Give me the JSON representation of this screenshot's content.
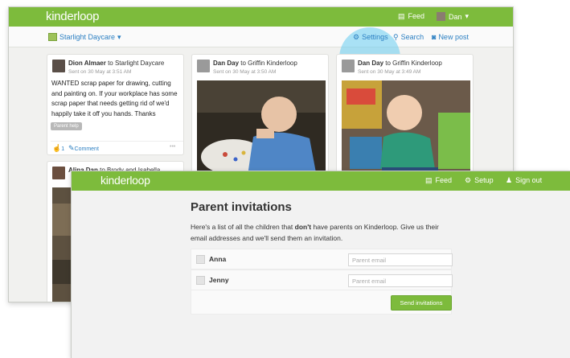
{
  "back_window": {
    "logo": "kinderloop",
    "nav": {
      "feed": "Feed",
      "user": "Dan"
    },
    "subnav": {
      "group": "Starlight Daycare",
      "settings": "Settings",
      "search": "Search",
      "new_post": "New post"
    },
    "posts": [
      {
        "author": "Dion Almaer",
        "to": "to Starlight Daycare",
        "sent": "Sent on 30 May at 3:51 AM",
        "text": "WANTED scrap paper for drawing, cutting and painting on. If your workplace has some scrap paper that needs getting rid of we'd happily take it off you hands. Thanks",
        "tag": "Parent help",
        "likes": "1",
        "comment": "Comment",
        "more": "•••"
      },
      {
        "author": "Dan Day",
        "to": "to Griffin Kinderloop",
        "sent": "Sent on 30 May at 3:50 AM"
      },
      {
        "author": "Dan Day",
        "to": "to Griffin Kinderloop",
        "sent": "Sent on 30 May at 3:49 AM"
      },
      {
        "author": "Alina Dan",
        "to": "to Brody and Isabella"
      }
    ]
  },
  "front_window": {
    "logo": "kinderloop",
    "nav": {
      "feed": "Feed",
      "setup": "Setup",
      "sign_out": "Sign out"
    },
    "title": "Parent invitations",
    "intro_before": "Here's a list of all the children that ",
    "intro_bold": "don't",
    "intro_after": " have parents on Kinderloop. Give us their email addresses and we'll send them an invitation.",
    "children": [
      {
        "name": "Anna",
        "placeholder": "Parent email"
      },
      {
        "name": "Jenny",
        "placeholder": "Parent email"
      }
    ],
    "send_button": "Send invitations"
  },
  "colors": {
    "brand_green": "#7dbb3c",
    "link_blue": "#2b7fc2",
    "highlight": "#66ccf0"
  }
}
